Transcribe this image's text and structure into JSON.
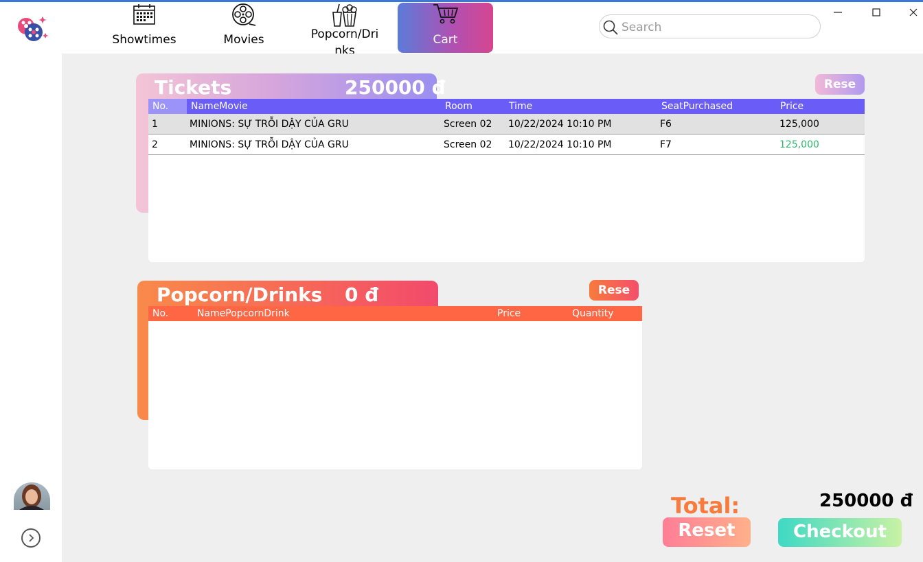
{
  "nav": {
    "items": [
      {
        "label": "Showtimes",
        "icon": "calendar-icon"
      },
      {
        "label": "Movies",
        "icon": "film-reel-icon"
      },
      {
        "label": "Popcorn/Dri\nnks",
        "icon": "popcorn-icon"
      },
      {
        "label": "Cart",
        "icon": "cart-icon",
        "active": true
      }
    ]
  },
  "search": {
    "placeholder": "Search"
  },
  "tickets": {
    "title": "Tickets",
    "amount": "250000 đ",
    "reset_label": "Rese",
    "columns": [
      "No.",
      "NameMovie",
      "Room",
      "Time",
      "SeatPurchased",
      "Price"
    ],
    "rows": [
      {
        "no": "1",
        "name": "MINIONS: SỰ TRỖI DẬY CỦA GRU",
        "room": "Screen 02",
        "time": "10/22/2024 10:10 PM",
        "seat": "F6",
        "price": "125,000"
      },
      {
        "no": "2",
        "name": "MINIONS: SỰ TRỖI DẬY CỦA GRU",
        "room": "Screen 02",
        "time": "10/22/2024 10:10 PM",
        "seat": "F7",
        "price": "125,000"
      }
    ]
  },
  "popcorn": {
    "title": "Popcorn/Drinks",
    "amount": "0 đ",
    "reset_label": "Rese",
    "columns": [
      "No.",
      "NamePopcornDrink",
      "Price",
      "Quantity"
    ]
  },
  "footer": {
    "total_label": "Total:",
    "total_value": "250000 đ",
    "reset_label": "Reset",
    "checkout_label": "Checkout"
  },
  "colors": {
    "ticket_header": "#6a5cf6",
    "popcorn_header": "#ff6644",
    "price_green": "#2eb86b",
    "reset_gradient_start": "#ff7e96",
    "checkout_gradient_start": "#3ed9c4"
  }
}
